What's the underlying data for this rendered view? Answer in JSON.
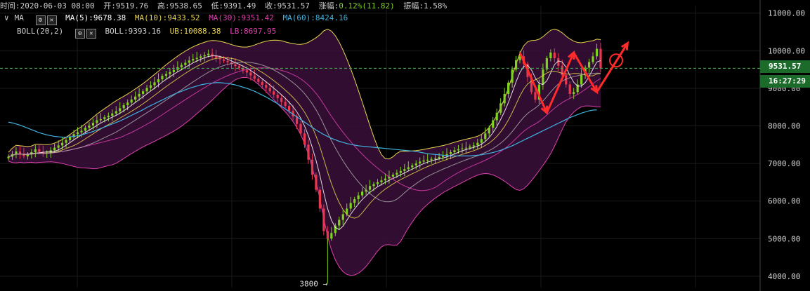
{
  "header": {
    "time_label": "时间:",
    "time": "2020-06-03 08:00",
    "open_label": "开:",
    "open": "9519.76",
    "high_label": "高:",
    "high": "9538.65",
    "low_label": "低:",
    "low": "9391.49",
    "close_label": "收:",
    "close": "9531.57",
    "change_label": "涨幅:",
    "change": "0.12%(11.82)",
    "amplitude_label": "振幅:",
    "amplitude": "1.58%"
  },
  "ma_row": {
    "chevron": "∨",
    "name": "MA",
    "settings_icon": "gear-icon",
    "close_icon": "close-icon",
    "ma5": "MA(5):9678.38",
    "ma10": "MA(10):9433.52",
    "ma30": "MA(30):9351.42",
    "ma60": "MA(60):8424.16"
  },
  "boll_row": {
    "name": "BOLL(20,2)",
    "boll": "BOLL:9393.16",
    "ub": "UB:10088.38",
    "lb": "LB:8697.95"
  },
  "price_tag": {
    "price": "9531.57",
    "countdown": "16:27:29"
  },
  "colors": {
    "up": "#7ed321",
    "down": "#e8384f",
    "ma5": "#ffffff",
    "ma10": "#e8d44d",
    "ma30": "#e040b0",
    "ma60": "#3fb4e0",
    "boll_band": "#d4a0d0",
    "annotation": "#ff2a2a",
    "price_up_tag": "#2e8b3a",
    "price_line": "#4caf50"
  },
  "chart_data": {
    "type": "candlestick",
    "y_axis": {
      "ticks": [
        4000,
        5000,
        6000,
        7000,
        8000,
        9000,
        10000,
        11000
      ],
      "tick_labels": [
        "4000.00",
        "5000.00",
        "6000.00",
        "7000.00",
        "8000.00",
        "9000.00",
        "10000.00",
        "11000.00"
      ],
      "range": [
        3700,
        11200
      ]
    },
    "last_price": 9531.57,
    "annotations": {
      "low_label": "3800",
      "low_value": 3800
    },
    "close_series": [
      7180,
      7250,
      7320,
      7260,
      7190,
      7240,
      7300,
      7380,
      7310,
      7260,
      7290,
      7350,
      7420,
      7480,
      7550,
      7620,
      7700,
      7780,
      7830,
      7870,
      7950,
      8010,
      8080,
      8150,
      8180,
      8230,
      8270,
      8330,
      8390,
      8470,
      8550,
      8620,
      8700,
      8780,
      8850,
      8920,
      9010,
      9080,
      9160,
      9240,
      9330,
      9380,
      9430,
      9490,
      9560,
      9620,
      9680,
      9740,
      9780,
      9810,
      9850,
      9880,
      9920,
      9860,
      9810,
      9770,
      9730,
      9690,
      9640,
      9590,
      9540,
      9480,
      9420,
      9340,
      9250,
      9170,
      9090,
      9010,
      8920,
      8830,
      8740,
      8640,
      8530,
      8400,
      8250,
      8050,
      7800,
      7500,
      7100,
      6700,
      6300,
      5800,
      5200,
      5000,
      5150,
      5350,
      5500,
      5650,
      5800,
      5950,
      6050,
      6150,
      6250,
      6300,
      6400,
      6450,
      6500,
      6550,
      6600,
      6650,
      6700,
      6750,
      6800,
      6850,
      6900,
      6950,
      7000,
      7050,
      7080,
      7100,
      7120,
      7140,
      7170,
      7200,
      7250,
      7300,
      7350,
      7380,
      7400,
      7420,
      7450,
      7480,
      7550,
      7650,
      7800,
      7950,
      8150,
      8350,
      8600,
      8850,
      9150,
      9500,
      9750,
      9850,
      9650,
      9300,
      8900,
      8700,
      9100,
      9500,
      9800,
      9950,
      9800,
      9600,
      9350,
      9100,
      8850,
      8900,
      9100,
      9350,
      9550,
      9700,
      9850,
      10050,
      9531.57
    ],
    "ma60_series": [
      8100,
      8080,
      8050,
      8020,
      7980,
      7940,
      7900,
      7860,
      7820,
      7790,
      7760,
      7740,
      7720,
      7710,
      7700,
      7700,
      7710,
      7720,
      7740,
      7760,
      7790,
      7820,
      7850,
      7890,
      7930,
      7970,
      8010,
      8050,
      8090,
      8130,
      8180,
      8230,
      8280,
      8330,
      8380,
      8430,
      8490,
      8540,
      8590,
      8640,
      8690,
      8740,
      8790,
      8840,
      8880,
      8920,
      8960,
      9000,
      9030,
      9060,
      9090,
      9110,
      9130,
      9140,
      9150,
      9150,
      9140,
      9130,
      9110,
      9090,
      9060,
      9030,
      9000,
      8960,
      8920,
      8870,
      8820,
      8770,
      8710,
      8650,
      8590,
      8520,
      8450,
      8380,
      8310,
      8240,
      8170,
      8100,
      8030,
      7960,
      7890,
      7830,
      7770,
      7720,
      7670,
      7630,
      7590,
      7560,
      7530,
      7510,
      7490,
      7470,
      7460,
      7450,
      7440,
      7430,
      7420,
      7410,
      7400,
      7390,
      7380,
      7370,
      7360,
      7350,
      7340,
      7330,
      7320,
      7300,
      7280,
      7260,
      7250,
      7240,
      7230,
      7220,
      7210,
      7200,
      7200,
      7200,
      7200,
      7200,
      7200,
      7210,
      7220,
      7230,
      7250,
      7270,
      7290,
      7320,
      7350,
      7390,
      7430,
      7470,
      7520,
      7570,
      7620,
      7670,
      7720,
      7770,
      7820,
      7870,
      7920,
      7970,
      8020,
      8070,
      8120,
      8170,
      8220,
      8260,
      8300,
      8340,
      8370,
      8400,
      8420,
      8424.16
    ]
  }
}
